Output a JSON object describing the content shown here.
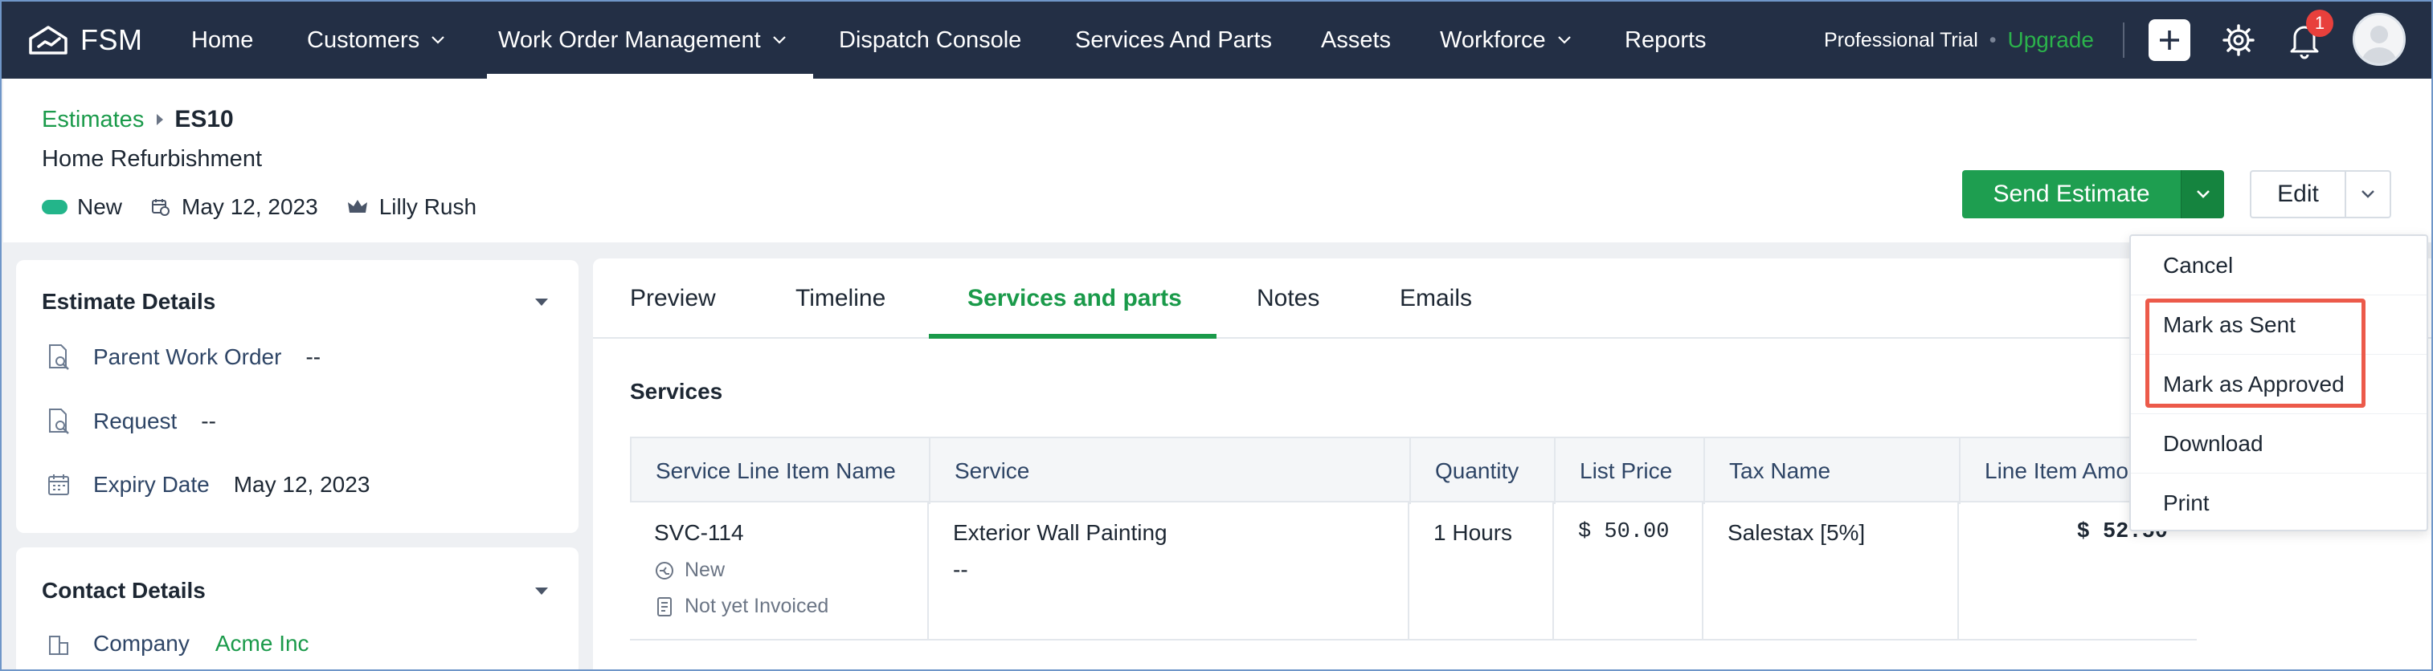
{
  "app": {
    "logo_text": "FSM"
  },
  "nav": {
    "items": [
      {
        "label": "Home"
      },
      {
        "label": "Customers"
      },
      {
        "label": "Work Order Management"
      },
      {
        "label": "Dispatch Console"
      },
      {
        "label": "Services And Parts"
      },
      {
        "label": "Assets"
      },
      {
        "label": "Workforce"
      },
      {
        "label": "Reports"
      }
    ],
    "active": "Work Order Management",
    "trial_label": "Professional Trial",
    "dot": "•",
    "upgrade_label": "Upgrade",
    "notification_count": "1"
  },
  "header": {
    "breadcrumb_link": "Estimates",
    "breadcrumb_current": "ES10",
    "subtitle": "Home Refurbishment",
    "status": "New",
    "date": "May 12, 2023",
    "owner": "Lilly Rush",
    "send_label": "Send Estimate",
    "edit_label": "Edit"
  },
  "estimate_details": {
    "title": "Estimate Details",
    "rows": [
      {
        "label": "Parent Work Order",
        "value": "--"
      },
      {
        "label": "Request",
        "value": "--"
      },
      {
        "label": "Expiry Date",
        "value": "May 12, 2023"
      }
    ]
  },
  "contact_details": {
    "title": "Contact Details",
    "company_label": "Company",
    "company_value": "Acme Inc"
  },
  "tabs": [
    "Preview",
    "Timeline",
    "Services and parts",
    "Notes",
    "Emails"
  ],
  "active_tab": "Services and parts",
  "services": {
    "title": "Services",
    "columns": [
      "Service Line Item Name",
      "Service",
      "Quantity",
      "List Price",
      "Tax Name",
      "Line Item Amo"
    ],
    "row": {
      "name": "SVC-114",
      "status": "New",
      "invoice_status": "Not yet Invoiced",
      "service": "Exterior Wall Painting",
      "service_sub": "--",
      "quantity": "1 Hours",
      "list_price": "$ 50.00",
      "tax_name": "Salestax [5%]",
      "amount": "$ 52.50"
    }
  },
  "menu": {
    "items": [
      "Cancel",
      "Mark as Sent",
      "Mark as Approved",
      "Download",
      "Print"
    ]
  },
  "colors": {
    "nav_bg": "#232f45",
    "accent": "#1a9a4a",
    "highlight": "#ec5a4a"
  }
}
